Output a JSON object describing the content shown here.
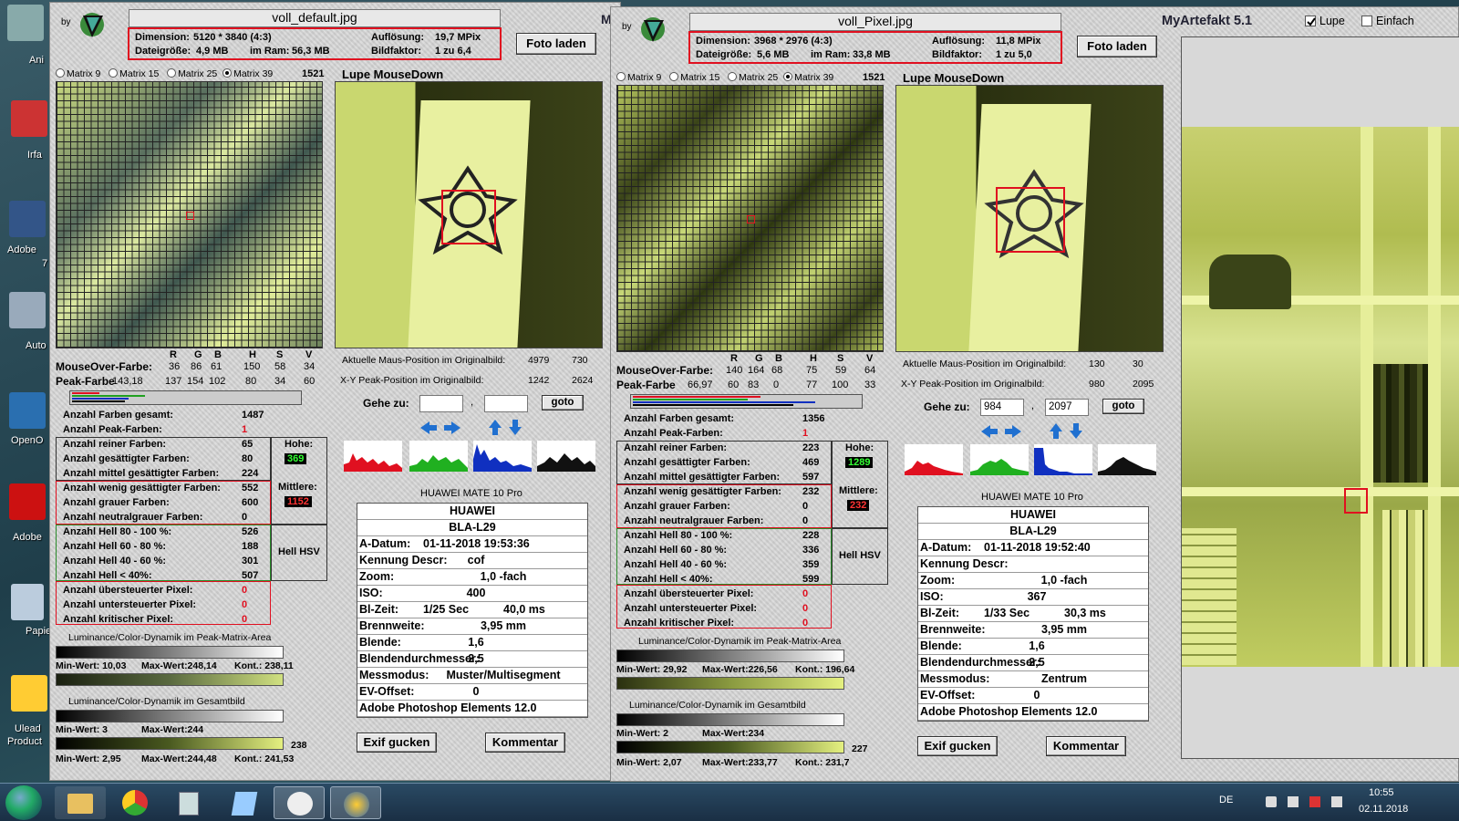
{
  "desktop": {
    "labels": [
      "Ani",
      "Irfa",
      "Adobe",
      "7",
      "Auto",
      "OpenO",
      "Adobe",
      "Papie",
      "Ulead",
      "Product"
    ]
  },
  "appname": "MyArtefakt 5.1",
  "options": {
    "lupe": "Lupe",
    "einfach": "Einfach"
  },
  "by": "by",
  "win1": {
    "filename": "voll_default.jpg",
    "dim_label": "Dimension:",
    "dim": "5120 * 3840 (4:3)",
    "res_label": "Auflösung:",
    "res": "19,7 MPix",
    "size_label": "Dateigröße:",
    "size": "4,9 MB",
    "ram_label": "im Ram:",
    "ram": "56,3 MB",
    "factor_label": "Bildfaktor:",
    "factor": "1 zu 6,4",
    "load_button": "Foto laden",
    "matrix": [
      "Matrix 9",
      "Matrix 15",
      "Matrix 25",
      "Matrix 39"
    ],
    "matrix_count": "1521",
    "lupe_title": "Lupe MouseDown",
    "rgb_head": [
      "R",
      "G",
      "B",
      "H",
      "S",
      "V"
    ],
    "mouseover_label": "MouseOver-Farbe:",
    "mouseover": [
      "36",
      "86",
      "61",
      "150",
      "58",
      "34"
    ],
    "peak_label": "Peak-Farbe",
    "peak": [
      "143,18",
      "137",
      "154",
      "102",
      "80",
      "34",
      "60"
    ],
    "pos_label": "Aktuelle Maus-Position  im Originalbild:",
    "pos": [
      "4979",
      "730"
    ],
    "peakpos_label": "X-Y Peak-Position  im Originalbild:",
    "peakpos": [
      "1242",
      "2624"
    ],
    "goto_label": "Gehe zu:",
    "goto_x": "",
    "goto_y": "",
    "goto_btn": "goto",
    "counts": [
      [
        "Anzahl Farben gesamt:",
        "1487"
      ],
      [
        "Anzahl Peak-Farben:",
        "1"
      ],
      [
        "Anzahl reiner Farben:",
        "65"
      ],
      [
        "Anzahl gesättigter Farben:",
        "80"
      ],
      [
        "Anzahl mittel gesättigter Farben:",
        "224"
      ],
      [
        "Anzahl wenig gesättigter Farben:",
        "552"
      ],
      [
        "Anzahl grauer Farben:",
        "600"
      ],
      [
        "Anzahl neutralgrauer Farben:",
        "0"
      ],
      [
        "Anzahl Hell 80 - 100 %:",
        "526"
      ],
      [
        "Anzahl Hell 60 - 80 %:",
        "188"
      ],
      [
        "Anzahl Hell 40 - 60 %:",
        "301"
      ],
      [
        "Anzahl Hell < 40%:",
        "507"
      ],
      [
        "Anzahl übersteuerter Pixel:",
        "0"
      ],
      [
        "Anzahl untersteuerter Pixel:",
        "0"
      ],
      [
        "Anzahl kritischer Pixel:",
        "0"
      ]
    ],
    "hohe_label": "Hohe:",
    "hohe": "369",
    "mittlere_label": "Mittlere:",
    "mittlere": "1152",
    "hell_label": "Hell HSV",
    "dyn1_title": "Luminance/Color-Dynamik im Peak-Matrix-Area",
    "dyn1": [
      "Min-Wert: 10,03",
      "Max-Wert:248,14",
      "Kont.: 238,11"
    ],
    "dyn2_title": "Luminance/Color-Dynamik im Gesamtbild",
    "dyn2a": [
      "Min-Wert: 3",
      "Max-Wert:244"
    ],
    "dyn2_val": "238",
    "dyn2b": [
      "Min-Wert: 2,95",
      "Max-Wert:244,48",
      "Kont.: 241,53"
    ],
    "camera": "HUAWEI MATE 10 Pro",
    "exif": [
      [
        "HUAWEI"
      ],
      [
        "BLA-L29"
      ],
      [
        "A-Datum:",
        "01-11-2018 19:53:36"
      ],
      [
        "Kennung Descr:",
        "cof"
      ],
      [
        "Zoom:",
        "1,0 -fach"
      ],
      [
        "ISO:",
        "400"
      ],
      [
        "Bl-Zeit:",
        "1/25 Sec",
        "40,0 ms"
      ],
      [
        "Brennweite:",
        "3,95  mm"
      ],
      [
        "Blende:",
        "1,6"
      ],
      [
        "Blendendurchmesser:",
        "2,5"
      ],
      [
        "Messmodus:",
        "Muster/Multisegment"
      ],
      [
        "EV-Offset:",
        "0"
      ],
      [
        "Adobe Photoshop Elements 12.0"
      ]
    ],
    "exif_btn": "Exif gucken",
    "comment_btn": "Kommentar"
  },
  "win2": {
    "filename": "voll_Pixel.jpg",
    "dim_label": "Dimension:",
    "dim": "3968 * 2976 (4:3)",
    "res_label": "Auflösung:",
    "res": "11,8 MPix",
    "size_label": "Dateigröße:",
    "size": "5,6 MB",
    "ram_label": "im Ram:",
    "ram": "33,8 MB",
    "factor_label": "Bildfaktor:",
    "factor": "1 zu 5,0",
    "load_button": "Foto laden",
    "matrix": [
      "Matrix 9",
      "Matrix 15",
      "Matrix 25",
      "Matrix 39"
    ],
    "matrix_count": "1521",
    "lupe_title": "Lupe MouseDown",
    "rgb_head": [
      "R",
      "G",
      "B",
      "H",
      "S",
      "V"
    ],
    "mouseover_label": "MouseOver-Farbe:",
    "mouseover": [
      "140",
      "164",
      "68",
      "75",
      "59",
      "64"
    ],
    "peak_label": "Peak-Farbe",
    "peak": [
      "66,97",
      "60",
      "83",
      "0",
      "77",
      "100",
      "33"
    ],
    "pos_label": "Aktuelle Maus-Position  im Originalbild:",
    "pos": [
      "130",
      "30"
    ],
    "peakpos_label": "X-Y Peak-Position  im Originalbild:",
    "peakpos": [
      "980",
      "2095"
    ],
    "goto_label": "Gehe zu:",
    "goto_x": "984",
    "goto_y": "2097",
    "goto_btn": "goto",
    "counts": [
      [
        "Anzahl Farben gesamt:",
        "1356"
      ],
      [
        "Anzahl Peak-Farben:",
        "1"
      ],
      [
        "Anzahl reiner Farben:",
        "223"
      ],
      [
        "Anzahl gesättigter Farben:",
        "469"
      ],
      [
        "Anzahl mittel gesättigter Farben:",
        "597"
      ],
      [
        "Anzahl wenig gesättigter Farben:",
        "232"
      ],
      [
        "Anzahl grauer Farben:",
        "0"
      ],
      [
        "Anzahl neutralgrauer Farben:",
        "0"
      ],
      [
        "Anzahl Hell 80 - 100 %:",
        "228"
      ],
      [
        "Anzahl Hell 60 - 80 %:",
        "336"
      ],
      [
        "Anzahl Hell 40 - 60 %:",
        "359"
      ],
      [
        "Anzahl Hell < 40%:",
        "599"
      ],
      [
        "Anzahl übersteuerter Pixel:",
        "0"
      ],
      [
        "Anzahl untersteuerter Pixel:",
        "0"
      ],
      [
        "Anzahl kritischer Pixel:",
        "0"
      ]
    ],
    "hohe_label": "Hohe:",
    "hohe": "1289",
    "mittlere_label": "Mittlere:",
    "mittlere": "232",
    "hell_label": "Hell HSV",
    "dyn1_title": "Luminance/Color-Dynamik im Peak-Matrix-Area",
    "dyn1": [
      "Min-Wert: 29,92",
      "Max-Wert:226,56",
      "Kont.: 196,64"
    ],
    "dyn2_title": "Luminance/Color-Dynamik im Gesamtbild",
    "dyn2a": [
      "Min-Wert: 2",
      "Max-Wert:234"
    ],
    "dyn2_val": "227",
    "dyn2b": [
      "Min-Wert: 2,07",
      "Max-Wert:233,77",
      "Kont.: 231,7"
    ],
    "camera": "HUAWEI MATE 10 Pro",
    "exif": [
      [
        "HUAWEI"
      ],
      [
        "BLA-L29"
      ],
      [
        "A-Datum:",
        "01-11-2018 19:52:40"
      ],
      [
        "Kennung Descr:",
        ""
      ],
      [
        "Zoom:",
        "1,0 -fach"
      ],
      [
        "ISO:",
        "367"
      ],
      [
        "Bl-Zeit:",
        "1/33 Sec",
        "30,3 ms"
      ],
      [
        "Brennweite:",
        "3,95  mm"
      ],
      [
        "Blende:",
        "1,6"
      ],
      [
        "Blendendurchmesser:",
        "2,5"
      ],
      [
        "Messmodus:",
        "Zentrum"
      ],
      [
        "EV-Offset:",
        "0"
      ],
      [
        "Adobe Photoshop Elements 12.0"
      ]
    ],
    "exif_btn": "Exif gucken",
    "comment_btn": "Kommentar"
  },
  "taskbar": {
    "lang": "DE",
    "time": "10:55",
    "date": "02.11.2018"
  },
  "colors": {
    "red": "#e01020",
    "accent_green": "#2a8a2a",
    "blue": "#1030c0"
  }
}
